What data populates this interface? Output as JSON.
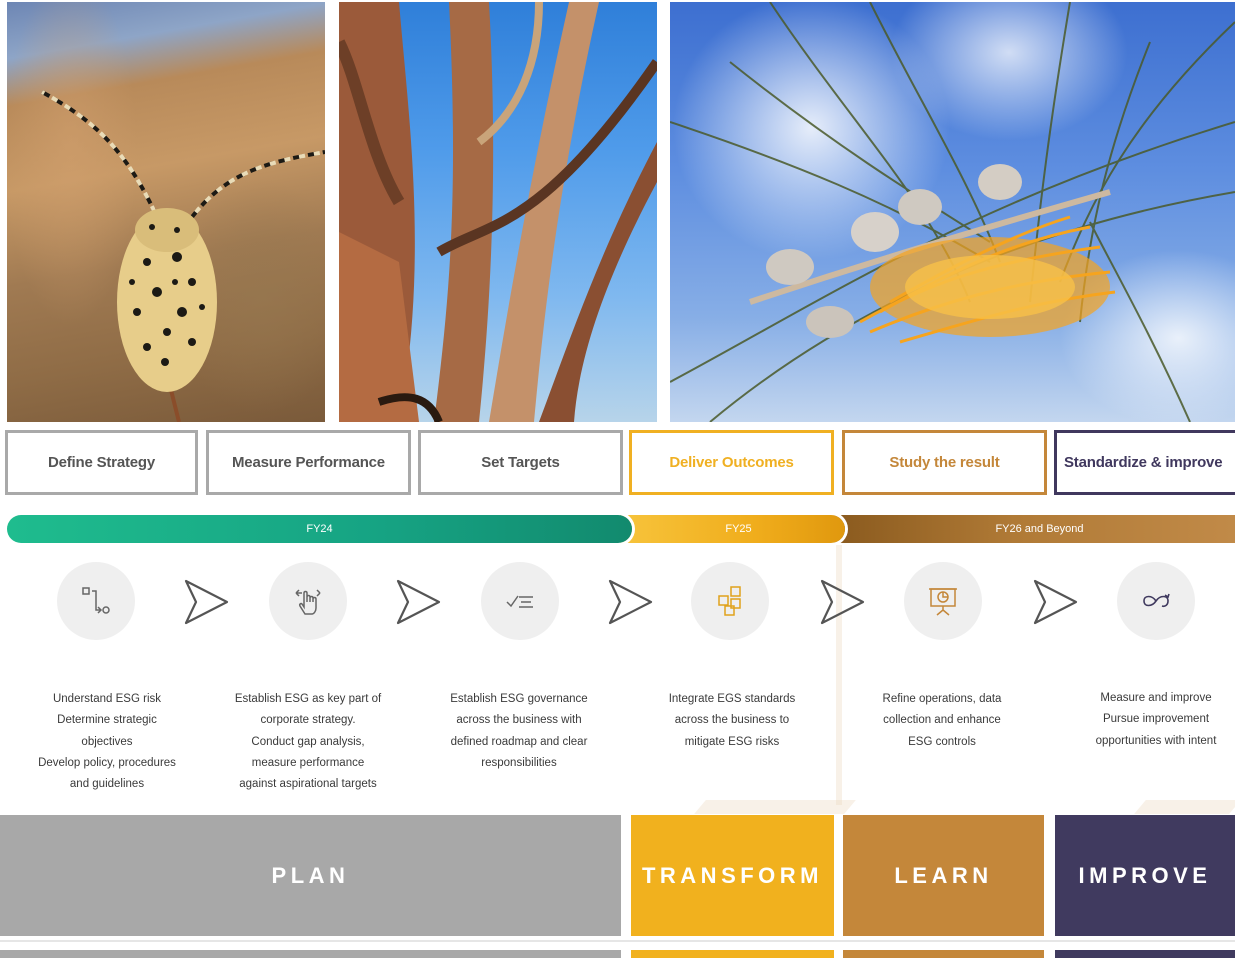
{
  "steps": [
    "Define Strategy",
    "Measure Performance",
    "Set Targets",
    "Deliver Outcomes",
    "Study the result",
    "Standardize & improve"
  ],
  "timeline": {
    "fy24": "FY24",
    "fy25": "FY25",
    "fy26": "FY26 and Beyond"
  },
  "icons": [
    "process-flow-icon",
    "gesture-hand-icon",
    "checklist-icon",
    "blocks-icon",
    "presentation-board-icon",
    "infinity-loop-icon"
  ],
  "descriptions": [
    [
      "Understand ESG risk",
      "Determine strategic",
      "objectives",
      "Develop policy, procedures",
      "and guidelines"
    ],
    [
      "Establish ESG as key part of",
      "corporate strategy.",
      "Conduct gap analysis,",
      "measure performance",
      "against aspirational targets"
    ],
    [
      "Establish ESG governance",
      "across the business with",
      "defined roadmap and clear",
      "responsibilities"
    ],
    [
      "Integrate EGS standards",
      "across the business to",
      "mitigate ESG risks"
    ],
    [
      "Refine operations, data",
      "collection and enhance",
      "ESG controls"
    ],
    [
      "Measure and improve",
      "Pursue improvement",
      "opportunities with intent"
    ]
  ],
  "phases": {
    "plan": "PLAN",
    "transform": "TRANSFORM",
    "learn": "LEARN",
    "improve": "IMPROVE"
  },
  "colors": {
    "plan": "#a8a8a8",
    "transform": "#f1b11e",
    "learn": "#c4873a",
    "improve": "#403a5f",
    "timeline_fy24": "#16a383",
    "timeline_fy25": "#f0ad1c",
    "timeline_fy26": "#b07a36"
  }
}
